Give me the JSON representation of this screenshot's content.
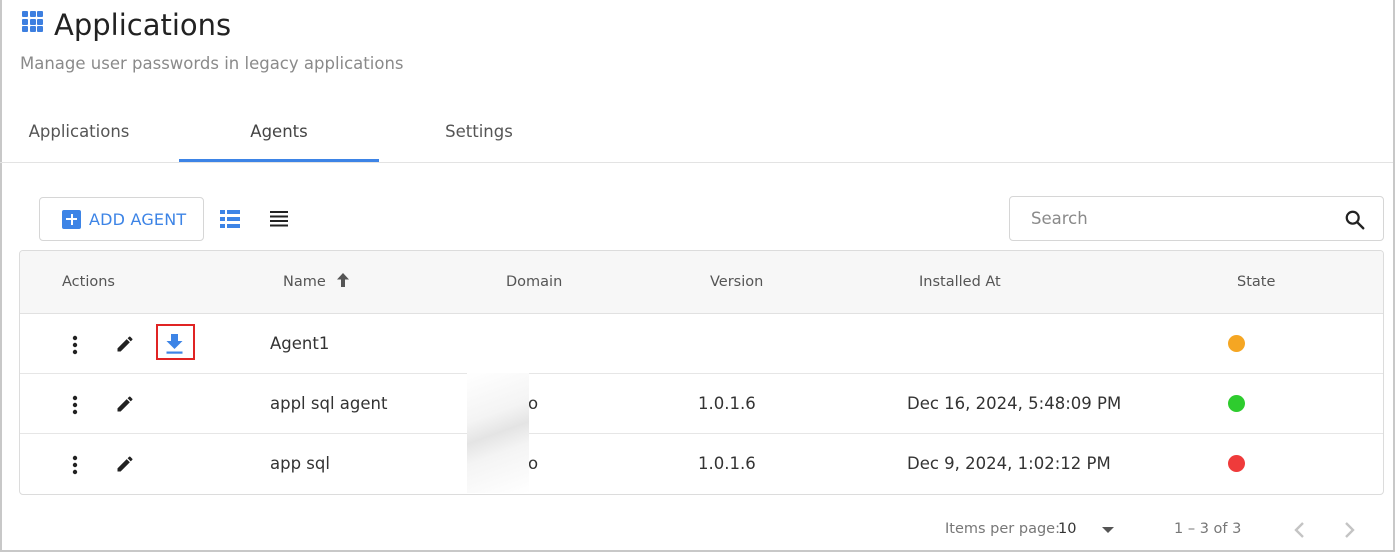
{
  "header": {
    "title": "Applications",
    "subtitle": "Manage user passwords in legacy applications",
    "icon": "apps-grid-icon"
  },
  "tabs": [
    {
      "label": "Applications",
      "active": false
    },
    {
      "label": "Agents",
      "active": true
    },
    {
      "label": "Settings",
      "active": false
    }
  ],
  "toolbar": {
    "add_label": "ADD AGENT",
    "view_modes": [
      "card-view-icon",
      "list-view-icon"
    ]
  },
  "search": {
    "placeholder": "Search",
    "value": ""
  },
  "table": {
    "columns": {
      "actions": "Actions",
      "name": "Name",
      "domain": "Domain",
      "version": "Version",
      "installed": "Installed At",
      "state": "State"
    },
    "sort": {
      "column": "Name",
      "direction": "ascending"
    },
    "rows": [
      {
        "name": "Agent1",
        "domain": "",
        "version": "",
        "installed": "",
        "state": "warning",
        "state_color": "#f5a623",
        "download": true
      },
      {
        "name": "appl sql agent",
        "domain": "o",
        "version": "1.0.1.6",
        "installed": "Dec 16, 2024, 5:48:09 PM",
        "state": "online",
        "state_color": "#2ecc2e",
        "download": false
      },
      {
        "name": "app sql",
        "domain": "o",
        "version": "1.0.1.6",
        "installed": "Dec 9, 2024, 1:02:12 PM",
        "state": "offline",
        "state_color": "#ef3b3b",
        "download": false
      }
    ]
  },
  "paginator": {
    "items_label": "Items per page:",
    "page_size": "10",
    "range": "1 – 3 of 3"
  },
  "colors": {
    "accent": "#3d84e6",
    "highlight": "#e02424"
  }
}
